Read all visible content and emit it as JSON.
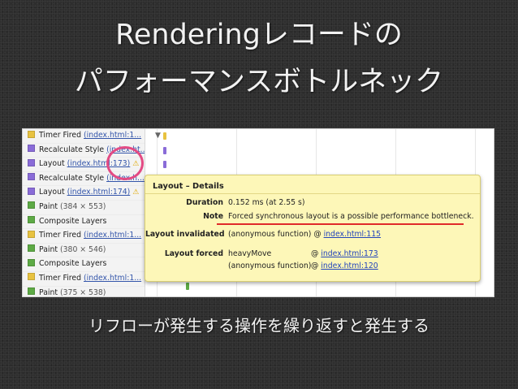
{
  "slide": {
    "title_line1": "Renderingレコードの",
    "title_line2": "パフォーマンスボトルネック",
    "caption": "リフローが発生する操作を繰り返すと発生する"
  },
  "records": [
    {
      "name": "Timer Fired",
      "link": "(index.html:1...",
      "meta": "",
      "color": "#e8c240",
      "warn": false
    },
    {
      "name": "Recalculate Style",
      "link": "(index.ht...",
      "meta": "",
      "color": "#8a6cd8",
      "warn": false
    },
    {
      "name": "Layout",
      "link": "(index.html:173)",
      "meta": "",
      "color": "#8a6cd8",
      "warn": true
    },
    {
      "name": "Recalculate Style",
      "link": "(index.h...",
      "meta": "",
      "color": "#8a6cd8",
      "warn": false
    },
    {
      "name": "Layout",
      "link": "(index.html:174)",
      "meta": "",
      "color": "#8a6cd8",
      "warn": true
    },
    {
      "name": "Paint",
      "link": "",
      "meta": "(384 × 553)",
      "color": "#5daa45",
      "warn": false
    },
    {
      "name": "Composite Layers",
      "link": "",
      "meta": "",
      "color": "#5daa45",
      "warn": false
    },
    {
      "name": "Timer Fired",
      "link": "(index.html:1...",
      "meta": "",
      "color": "#e8c240",
      "warn": false
    },
    {
      "name": "Paint",
      "link": "",
      "meta": "(380 × 546)",
      "color": "#5daa45",
      "warn": false
    },
    {
      "name": "Composite Layers",
      "link": "",
      "meta": "",
      "color": "#5daa45",
      "warn": false
    },
    {
      "name": "Timer Fired",
      "link": "(index.html:1...",
      "meta": "",
      "color": "#e8c240",
      "warn": false
    },
    {
      "name": "Paint",
      "link": "",
      "meta": "(375 × 538)",
      "color": "#5daa45",
      "warn": false
    }
  ],
  "details": {
    "title": "Layout – Details",
    "duration_label": "Duration",
    "duration_value": "0.152 ms (at 2.55 s)",
    "note_label": "Note",
    "note_value": "Forced synchronous layout is a possible performance bottleneck.",
    "invalidated_label": "Layout invalidated",
    "invalidated_fn": "(anonymous function)",
    "invalidated_at": "@",
    "invalidated_link": "index.html:115",
    "forced_label": "Layout forced",
    "forced_fn1": "heavyMove",
    "forced_at1": "@",
    "forced_link1": "index.html:173",
    "forced_fn2": "(anonymous function)",
    "forced_at2": "@",
    "forced_link2": "index.html:120"
  },
  "colors": {
    "highlight": "#e34b84",
    "underline": "#e02a2a",
    "popover_bg": "#fdf7b8"
  }
}
